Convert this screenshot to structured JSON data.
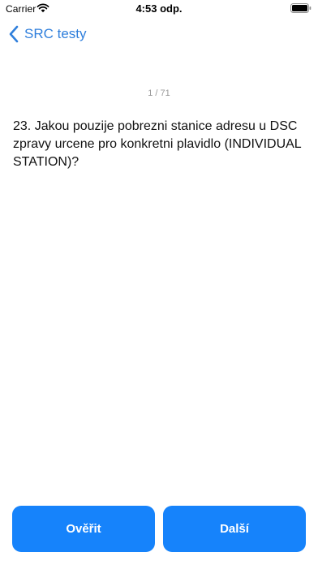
{
  "status_bar": {
    "carrier": "Carrier",
    "time": "4:53 odp."
  },
  "nav": {
    "back_label": "SRC testy"
  },
  "counter": "1 / 71",
  "question": "23. Jakou pouzije pobrezni stanice adresu u DSC zpravy urcene pro konkretni plavidlo (INDIVIDUAL STATION)?",
  "buttons": {
    "verify_label": "Ověřit",
    "next_label": "Další"
  },
  "colors": {
    "accent": "#1683fb",
    "nav_tint": "#2f7fdc",
    "counter_text": "#9a9a9a"
  },
  "icons": {
    "wifi": "wifi-icon",
    "battery": "battery-icon",
    "back": "chevron-left-icon"
  }
}
